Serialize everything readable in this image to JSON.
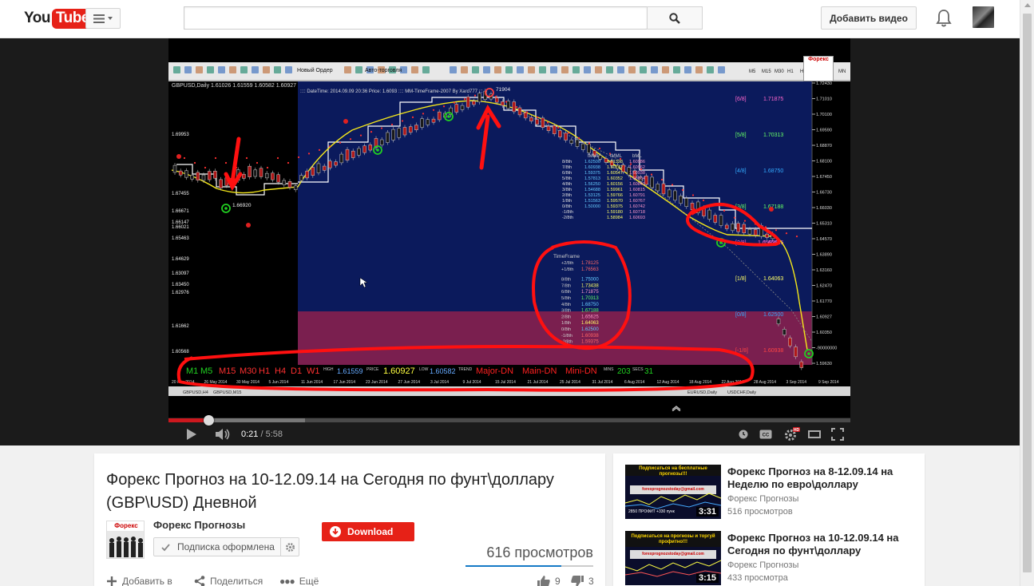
{
  "header": {
    "logo_you": "You",
    "logo_tube": "Tube",
    "upload_label": "Добавить видео"
  },
  "player": {
    "current_time": "0:21",
    "duration": "5:58",
    "played_fraction": 0.059,
    "loaded_fraction": 0.2,
    "video_frame": {
      "chart_title": "GBPUSD,Daily 1.61026 1.61559 1.60582 1.60927",
      "chart_subtitle": ":::: DateTime: 2014.09.09 20:36  Price: 1.6093 :::: MM-TimeFrame-2007 By Xard777 :::",
      "toolbar_new_order": "Новый Ордер",
      "toolbar_autotrade": "Авто-торговля",
      "timeframes": [
        "M5",
        "M15",
        "M30",
        "H1",
        "H4",
        "D1",
        "W1",
        "MN"
      ],
      "price_axis": [
        "1.72430",
        "1.71010",
        "1.70100",
        "1.69590",
        "1.68870",
        "1.68100",
        "1.67450",
        "1.66730",
        "1.66030",
        "1.65310",
        "1.64570",
        "1.63890",
        "1.63160",
        "1.62470",
        "1.61770",
        "1.60927",
        "1.60350",
        "-90000000",
        "1.59630"
      ],
      "left_price_labels": [
        "1.69953",
        "1.67455",
        "1.66671",
        "1.66147",
        "1.66021",
        "1.65463",
        "1.64629",
        "1.63097",
        "1.63450",
        "1.62976",
        "1.61662",
        "1.60568"
      ],
      "murrey_levels": [
        {
          "label": "[6/8]",
          "value": "1.71875",
          "color": "#ff66cc"
        },
        {
          "label": "[5/8]",
          "value": "1.70313",
          "color": "#66ff66"
        },
        {
          "label": "[4/8]",
          "value": "1.68750",
          "color": "#33aaff"
        },
        {
          "label": "[3/8]",
          "value": "1.67188",
          "color": "#66ff66"
        },
        {
          "label": "[2/8]",
          "value": "1.65625",
          "color": "#ff66cc"
        },
        {
          "label": "[1/8]",
          "value": "1.64063",
          "color": "#ffff66"
        },
        {
          "label": "[0/8]",
          "value": "1.62500",
          "color": "#33aaff"
        },
        {
          "label": "[-1/8]",
          "value": "1.60938",
          "color": "#ff4444"
        }
      ],
      "mml_table_header": [
        "tMML",
        "tMML",
        "bML"
      ],
      "mml_rows": [
        [
          "8/8th",
          "1.62500",
          "1.61328",
          "1.60986"
        ],
        [
          "7/8th",
          "1.60938",
          "1.60742",
          "1.60962"
        ],
        [
          "6/8th",
          "1.59375",
          "1.60547",
          "1.60938"
        ],
        [
          "5/8th",
          "1.57813",
          "1.60352",
          "1.60864"
        ],
        [
          "4/8th",
          "1.56250",
          "1.60156",
          "1.60840"
        ],
        [
          "3/8th",
          "1.54688",
          "1.59961",
          "1.60815"
        ],
        [
          "2/8th",
          "1.53125",
          "1.59766",
          "1.60791"
        ],
        [
          "1/8th",
          "1.51563",
          "1.59570",
          "1.60767"
        ],
        [
          "0/8th",
          "1.50000",
          "1.59375",
          "1.60742"
        ],
        [
          "-1/8th",
          "",
          "1.59180",
          "1.60718"
        ],
        [
          "-2/8th",
          "",
          "1.58984",
          "1.60693"
        ]
      ],
      "timeframe_table_title": "TimeFrame",
      "timeframe_rows": [
        [
          "+2/8th",
          "1.78125"
        ],
        [
          "+1/8th",
          "1.76563"
        ],
        [
          "8/8th",
          "1.75000"
        ],
        [
          "7/8th",
          "1.73438"
        ],
        [
          "6/8th",
          "1.71875"
        ],
        [
          "5/8th",
          "1.70313"
        ],
        [
          "4/8th",
          "1.68750"
        ],
        [
          "3/8th",
          "1.67188"
        ],
        [
          "2/8th",
          "1.65625"
        ],
        [
          "1/8th",
          "1.64063"
        ],
        [
          "0/8th",
          "1.62500"
        ],
        [
          "-1/8th",
          "1.60938"
        ],
        [
          "-2/8th",
          "1.59375"
        ]
      ],
      "bottom_panel": {
        "tf_labels": [
          "M1",
          "M5",
          "M15",
          "M30",
          "H1",
          "H4",
          "D1",
          "W1"
        ],
        "high_label": "HIGH",
        "high_value": "1.61559",
        "price_label": "PRICE",
        "price_value": "1.60927",
        "low_label": "LOW",
        "low_value": "1.60582",
        "trend_label": "TREND",
        "trends": [
          "Major-DN",
          "Main-DN",
          "Mini-DN"
        ],
        "mins_label": "MINS",
        "mins_value": "203",
        "secs_label": "SECS",
        "secs_value": "31"
      },
      "date_axis": [
        "20 Nov 2014",
        "26 May 2014",
        "30 May 2014",
        "5 Jun 2014",
        "11 Jun 2014",
        "17 Jun 2014",
        "23 Jun 2014",
        "27 Jun 2014",
        "3 Jul 2014",
        "9 Jul 2014",
        "15 Jul 2014",
        "21 Jul 2014",
        "25 Jul 2014",
        "31 Jul 2014",
        "6 Aug 2014",
        "12 Aug 2014",
        "18 Aug 2014",
        "22 Aug 2014",
        "28 Aug 2014",
        "3 Sep 2014",
        "9 Sep 2014"
      ],
      "tab_labels": [
        "GBPUSD,H4",
        "GBPUSD,M15",
        "EURUSD,Daily",
        "USDCHF,Daily"
      ],
      "annotations": [
        "71904",
        "1.66920",
        "1.65625"
      ],
      "overlay_brand": "Форекс"
    }
  },
  "video": {
    "title": "Форекс Прогноз на 10-12.09.14 на Сегодня по фунт\\доллару (GBP\\USD) Дневной",
    "channel_name": "Форекс Прогнозы",
    "subscribe_label": "Подписка оформлена",
    "download_label": "Download",
    "views": "616 просмотров",
    "views_like_fraction": 0.75,
    "add_to_label": "Добавить в",
    "share_label": "Поделиться",
    "more_label": "Ещё",
    "likes": "9",
    "dislikes": "3",
    "channel_avatar_text": "Форекс"
  },
  "related": [
    {
      "title": "Форекс Прогноз на 8-12.09.14 на Неделю по евро\\доллару",
      "channel": "Форекс Прогнозы",
      "views": "516 просмотров",
      "duration": "3:31",
      "thumb_top_text": "Подписаться на бесплатные прогнозы!!!",
      "thumb_price_text": "2850   ПРОФИТ  +330 пунк",
      "thumb_email": "forexprognozstoday@gmail.com"
    },
    {
      "title": "Форекс Прогноз на 10-12.09.14 на Сегодня по фунт\\доллару",
      "channel": "Форекс Прогнозы",
      "views": "433 просмотра",
      "duration": "3:15",
      "thumb_top_text": "Подписаться на прогнозы и торгуй профитно!!!",
      "thumb_email": "forexprognozstoday@gmail.com"
    }
  ],
  "colors": {
    "accent_red": "#e62117",
    "progress_red": "#cc181e",
    "chart_bg": "#0b1a5c",
    "chart_bg_dark": "#000000",
    "pink_zone": "#7a1f4f",
    "annotation_red": "#ff0000"
  }
}
